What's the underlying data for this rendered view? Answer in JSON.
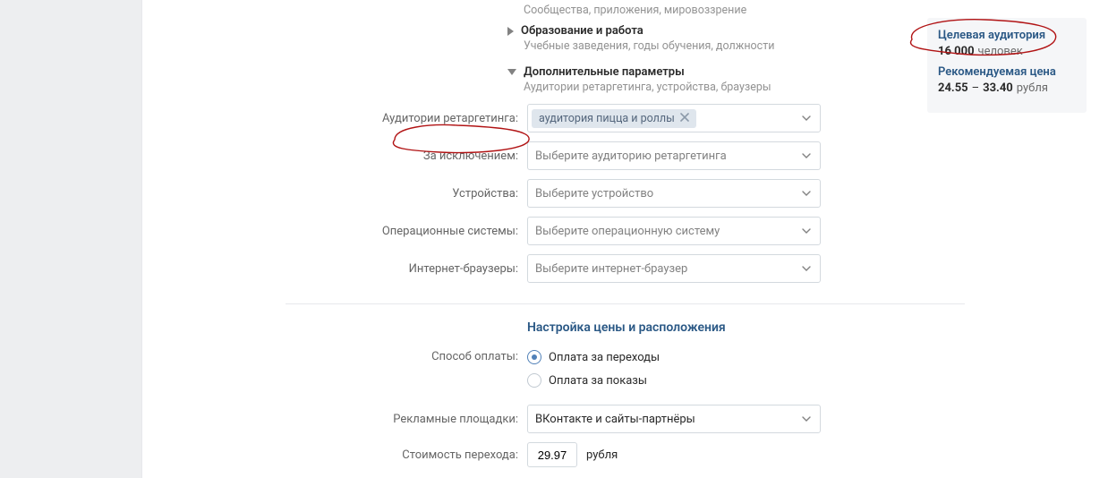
{
  "groups": {
    "top_sub": "Сообщества, приложения, мировоззрение",
    "education": {
      "title": "Образование и работа",
      "sub": "Учебные заведения, годы обучения, должности"
    },
    "additional": {
      "title": "Дополнительные параметры",
      "sub": "Аудитории ретаргетинга, устройства, браузеры"
    }
  },
  "fields": {
    "retargeting": {
      "label": "Аудитории ретаргетинга:",
      "tag": "аудитория пицца и роллы"
    },
    "exclude": {
      "label": "За исключением:",
      "placeholder": "Выберите аудиторию ретаргетинга"
    },
    "devices": {
      "label": "Устройства:",
      "placeholder": "Выберите устройство"
    },
    "os": {
      "label": "Операционные системы:",
      "placeholder": "Выберите операционную систему"
    },
    "browsers": {
      "label": "Интернет-браузеры:",
      "placeholder": "Выберите интернет-браузер"
    }
  },
  "pricing": {
    "section_title": "Настройка цены и расположения",
    "pay_method_label": "Способ оплаты:",
    "pay_clicks": "Оплата за переходы",
    "pay_impressions": "Оплата за показы",
    "placements_label": "Рекламные площадки:",
    "placements_value": "ВКонтакте и сайты-партнёры",
    "cpc_label": "Стоимость перехода:",
    "cpc_value": "29.97",
    "cpc_unit": "рубля"
  },
  "sidebar": {
    "audience_header": "Целевая аудитория",
    "audience_count": "16 000",
    "audience_unit": "человек",
    "price_header": "Рекомендуемая цена",
    "price_low": "24.55",
    "price_high": "33.40",
    "price_unit": "рубля"
  }
}
